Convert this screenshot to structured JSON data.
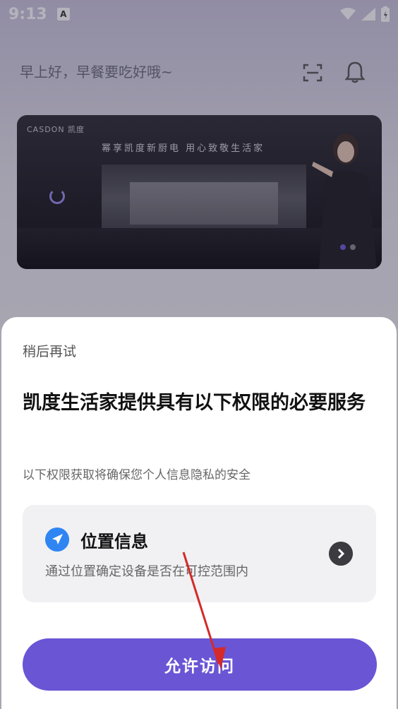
{
  "status_bar": {
    "time": "9:13",
    "a_icon": "A"
  },
  "home": {
    "greeting": "早上好，早餐要吃好哦~",
    "banner": {
      "brand": "CASDON 凯度",
      "slogan": "幂享凯度新厨电   用心致敬生活家"
    }
  },
  "sheet": {
    "later_label": "稍后再试",
    "title": "凯度生活家提供具有以下权限的必要服务",
    "subtitle": "以下权限获取将确保您个人信息隐私的安全",
    "permission": {
      "title": "位置信息",
      "description": "通过位置确定设备是否在可控范围内"
    },
    "allow_label": "允许访问"
  },
  "colors": {
    "accent": "#6a55d5",
    "location_icon": "#2f86f3",
    "annotation_arrow": "#d42a2a"
  },
  "icons": [
    "scan-icon",
    "bell-icon",
    "location-arrow-icon",
    "chevron-right-icon",
    "wifi-icon",
    "signal-icon",
    "battery-icon"
  ]
}
